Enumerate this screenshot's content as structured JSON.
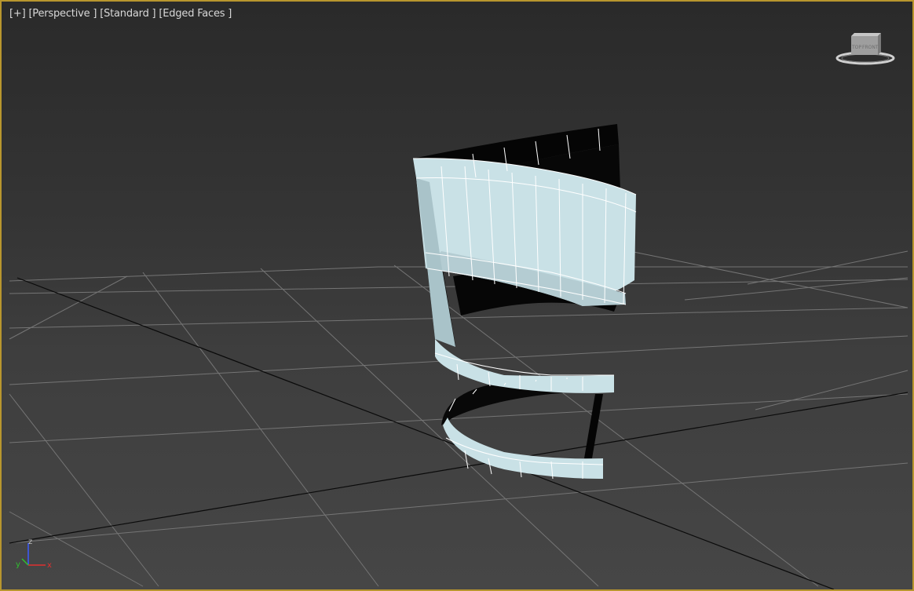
{
  "viewport": {
    "labels": [
      {
        "id": "plus",
        "text": "[+]"
      },
      {
        "id": "view",
        "text": "[Perspective ]"
      },
      {
        "id": "shading",
        "text": "[Standard ]"
      },
      {
        "id": "display",
        "text": "[Edged Faces ]"
      }
    ],
    "border_color": "#b8962e"
  },
  "viewcube": {
    "top_label": "TOP",
    "front_label": "FRONT"
  },
  "axis": {
    "x": "x",
    "y": "y",
    "z": "z"
  },
  "colors": {
    "surface": "#c9e1e6",
    "grid": "#727272",
    "grid_axis": "#0a0a0a",
    "background_top": "#2a2a2a",
    "background_bottom": "#464646"
  }
}
